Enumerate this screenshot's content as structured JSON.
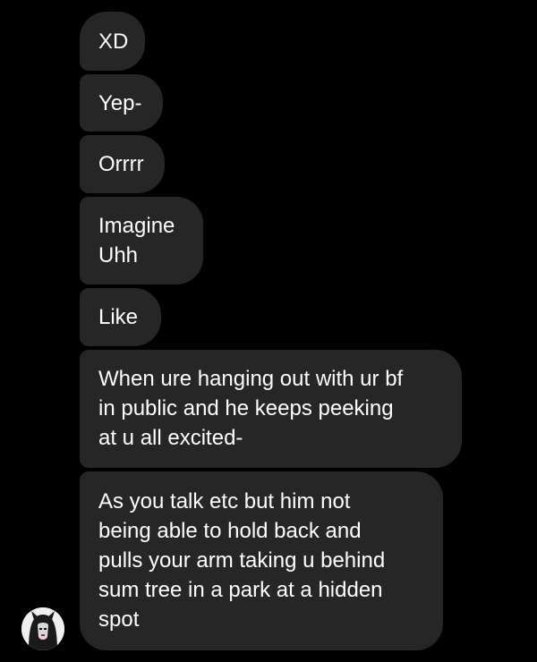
{
  "conversation": {
    "messages": [
      {
        "lines": [
          "XD"
        ]
      },
      {
        "lines": [
          "Yep-"
        ]
      },
      {
        "lines": [
          "Orrrr"
        ]
      },
      {
        "lines": [
          "Imagine",
          "Uhh"
        ]
      },
      {
        "lines": [
          "Like"
        ]
      },
      {
        "lines": [
          "When ure hanging out with ur bf",
          "in public and he keeps peeking",
          "at u all excited-"
        ]
      },
      {
        "lines": [
          "As you talk etc but him not",
          "being able to hold back and",
          "pulls your arm taking u behind",
          "sum tree in a park at a hidden",
          "spot"
        ]
      }
    ]
  },
  "sender": {
    "avatar_icon": "profile-avatar"
  },
  "colors": {
    "background": "#000000",
    "bubble": "#262626",
    "text": "#ffffff"
  }
}
